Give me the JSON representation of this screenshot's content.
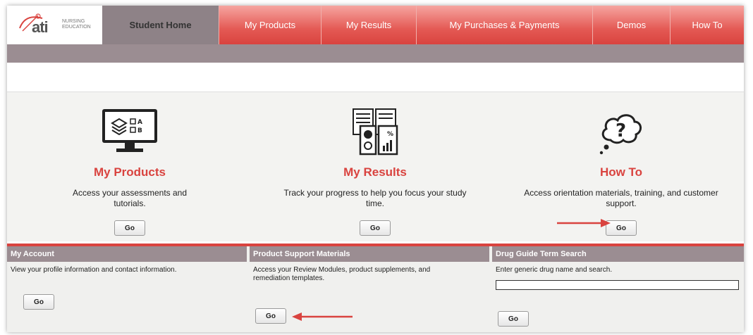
{
  "logo": {
    "wordmark": "ati",
    "subtitle_line1": "NURSING",
    "subtitle_line2": "EDUCATION"
  },
  "nav": {
    "student_home": "Student Home",
    "my_products": "My Products",
    "my_results": "My Results",
    "my_purchases": "My Purchases & Payments",
    "demos": "Demos",
    "how_to": "How To"
  },
  "tiles": [
    {
      "title": "My Products",
      "desc": "Access your assessments and tutorials.",
      "go": "Go"
    },
    {
      "title": "My Results",
      "desc": "Track your progress to help you focus your study time.",
      "go": "Go"
    },
    {
      "title": "How To",
      "desc": "Access orientation materials, training, and customer support.",
      "go": "Go"
    }
  ],
  "panels": [
    {
      "header": "My Account",
      "text": "View your profile information and contact information.",
      "go": "Go"
    },
    {
      "header": "Product Support Materials",
      "text": "Access your Review Modules, product supplements, and remediation templates.",
      "go": "Go"
    },
    {
      "header": "Drug Guide Term Search",
      "text": "Enter generic drug name and search.",
      "input_value": "",
      "go": "Go"
    }
  ],
  "colors": {
    "accent_red": "#d9433f",
    "nav_gray": "#9b8d92"
  }
}
